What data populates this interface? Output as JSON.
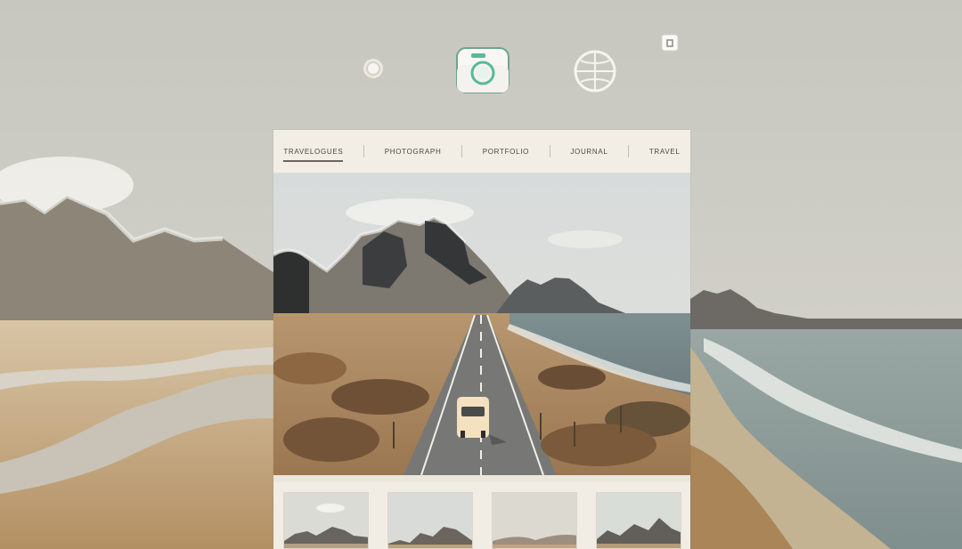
{
  "nav": {
    "items": [
      {
        "label": "TRAVELOGUES"
      },
      {
        "label": "PHOTOGRAPH"
      },
      {
        "label": "PORTFOLIO"
      },
      {
        "label": "JOURNAL"
      },
      {
        "label": "TRAVEL"
      }
    ]
  },
  "icons": {
    "top_left": "circle-dot-icon",
    "top_center": "camera-icon",
    "top_right": "globe-icon",
    "corner": "small-badge-icon"
  },
  "colors": {
    "background": "#c9c8c0",
    "panel": "#ece7dd",
    "accent": "#58b99b"
  }
}
